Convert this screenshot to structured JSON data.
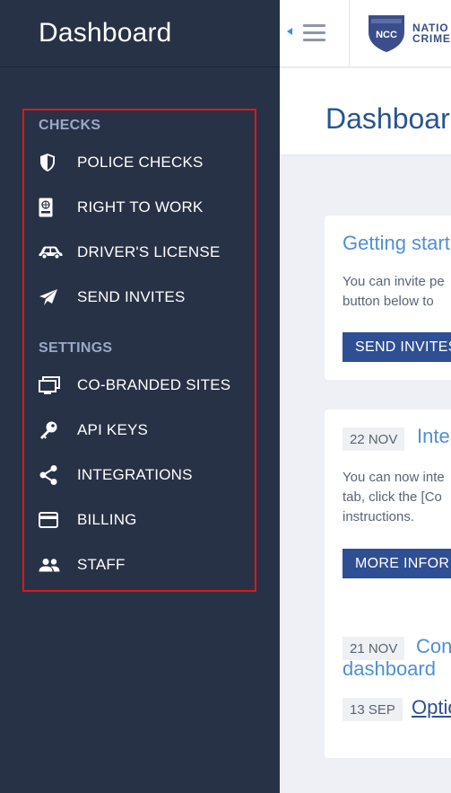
{
  "sidebar": {
    "title": "Dashboard",
    "sections": {
      "checks": "CHECKS",
      "settings": "SETTINGS"
    },
    "items": {
      "police_checks": "POLICE CHECKS",
      "right_to_work": "RIGHT TO WORK",
      "drivers_license": "DRIVER'S LICENSE",
      "send_invites": "SEND INVITES",
      "co_branded_sites": "CO-BRANDED SITES",
      "api_keys": "API KEYS",
      "integrations": "INTEGRATIONS",
      "billing": "BILLING",
      "staff": "STAFF"
    }
  },
  "topbar": {
    "logo_abbr": "NCC",
    "logo_line1": "NATIO",
    "logo_line2": "CRIME"
  },
  "main": {
    "page_title": "Dashboar",
    "getting_started": {
      "title": "Getting start",
      "text_line1": "You can invite pe",
      "text_line2": "button below to",
      "button": "SEND INVITES"
    },
    "news": {
      "item1_date": "22 NOV",
      "item1_title": "Inte",
      "item1_text_line1": "You can now inte",
      "item1_text_line2": "tab, click the [Co",
      "item1_text_line3": "instructions.",
      "more_button": "MORE INFOR",
      "item2_date": "21 NOV",
      "item2_title_line1": "Con",
      "item2_title_line2": "dashboard",
      "item3_date": "13 SEP",
      "item3_title": "Optio"
    }
  },
  "colors": {
    "sidebar_bg": "#283246",
    "accent": "#2f4f94",
    "highlight": "#e3141b",
    "link": "#4f8fd6"
  }
}
